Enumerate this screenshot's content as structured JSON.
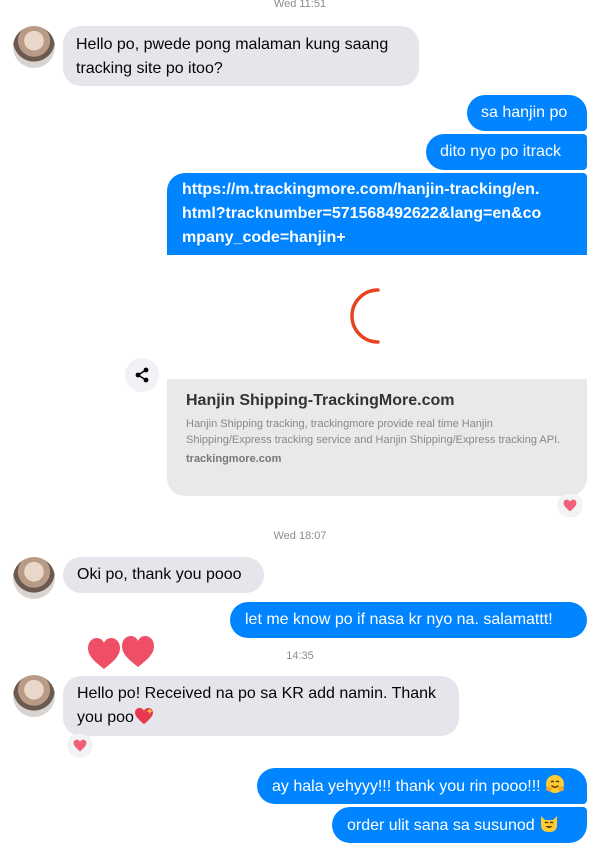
{
  "timestamps": {
    "t1": "Wed 11:51",
    "t2": "Wed 18:07",
    "t3": "14:35"
  },
  "messages": {
    "m1": "Hello po, pwede pong malaman kung saang tracking site po itoo?",
    "m2": "sa hanjin po",
    "m3": "dito nyo po itrack",
    "m4_line1": "https://m.trackingmore.com/hanjin-tracking/en.",
    "m4_line2": "html?tracknumber=571568492622&lang=en&co",
    "m4_line3": "mpany_code=hanjin+",
    "m5": "Oki po, thank you pooo",
    "m6": "let me know po if nasa kr nyo na. salamattt!",
    "m7_line1": "Hello po! Received na po sa KR add namin. Thank",
    "m7_line2": "you poo",
    "m8": "ay hala yehyyy!!! thank you rin pooo!!!",
    "m9": "order ulit sana sa susunod"
  },
  "link_preview": {
    "title": "Hanjin Shipping-TrackingMore.com",
    "description": "Hanjin Shipping tracking, trackingmore provide real time Hanjin Shipping/Express tracking service and Hanjin Shipping/Express tracking API.",
    "domain": "trackingmore.com"
  },
  "icons": {
    "share": "share-icon",
    "reaction": "heart-reaction-icon",
    "spinner": "loading-spinner-icon",
    "emoji_heart": "sparkling-heart-emoji",
    "emoji_hug": "hugging-face-emoji",
    "emoji_cat": "grinning-cat-emoji"
  },
  "colors": {
    "outgoing": "#0084ff",
    "incoming": "#e4e6eb",
    "heart": "#f25f7a",
    "spinner": "#e8441f"
  }
}
